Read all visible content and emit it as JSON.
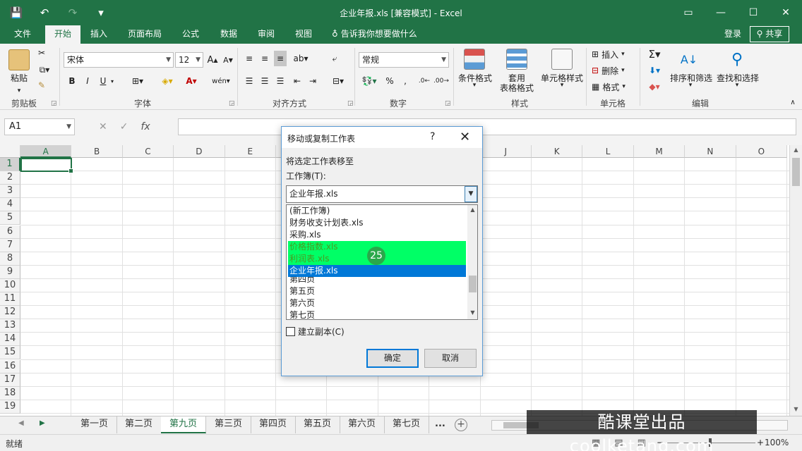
{
  "window": {
    "title": "企业年报.xls  [兼容模式] - Excel"
  },
  "qat": {
    "save": "💾",
    "undo": "↶",
    "redo": "↷",
    "more": "▾"
  },
  "ribbon_tabs": [
    "文件",
    "开始",
    "插入",
    "页面布局",
    "公式",
    "数据",
    "审阅",
    "视图"
  ],
  "active_tab": "开始",
  "tell_me": "告诉我你想要做什么",
  "account": {
    "login": "登录",
    "share": "共享"
  },
  "ribbon": {
    "clipboard": {
      "label": "剪贴板",
      "paste": "粘贴"
    },
    "font": {
      "label": "字体",
      "name": "宋体",
      "size": "12",
      "bold": "B",
      "italic": "I",
      "underline": "U"
    },
    "alignment": {
      "label": "对齐方式"
    },
    "number": {
      "label": "数字",
      "format": "常规",
      "percent": "%"
    },
    "styles": {
      "label": "样式",
      "conditional": "条件格式",
      "table_line1": "套用",
      "table_line2": "表格格式",
      "cell_styles": "单元格样式"
    },
    "cells": {
      "label": "单元格",
      "insert": "插入",
      "delete": "删除",
      "format": "格式"
    },
    "editing": {
      "label": "编辑",
      "sort": "排序和筛选",
      "find": "查找和选择"
    }
  },
  "formula_bar": {
    "name_box": "A1",
    "cancel": "✕",
    "enter": "✓",
    "fx": "fx",
    "value": ""
  },
  "columns": [
    "A",
    "B",
    "C",
    "D",
    "E",
    "F",
    "G",
    "H",
    "I",
    "J",
    "K",
    "L",
    "M",
    "N",
    "O"
  ],
  "rows": [
    "1",
    "2",
    "3",
    "4",
    "5",
    "6",
    "7",
    "8",
    "9",
    "10",
    "11",
    "12",
    "13",
    "14",
    "15",
    "16",
    "17",
    "18",
    "19"
  ],
  "sheets": [
    "第一页",
    "第二页",
    "第九页",
    "第三页",
    "第四页",
    "第五页",
    "第六页",
    "第七页"
  ],
  "active_sheet": "第九页",
  "sheets_more": "...",
  "status": {
    "text": "就绪",
    "zoom": "100%"
  },
  "watermark": "酷课堂出品 coolketang.com",
  "dialog": {
    "title": "移动或复制工作表",
    "help": "?",
    "close": "✕",
    "move_to_label": "将选定工作表移至",
    "workbook_label": "工作簿(T):",
    "workbook_value": "企业年报.xls",
    "list_items": [
      "(新工作簿)",
      "财务收支计划表.xls",
      "采购.xls",
      "价格指数.xls",
      "利润表.xls",
      "企业年报.xls",
      "第四页",
      "第五页",
      "第六页",
      "第七页"
    ],
    "highlighted_item": "利润表.xls",
    "selected_item": "企业年报.xls",
    "copy_label": "建立副本(C)",
    "ok": "确定",
    "cancel": "取消",
    "step_badge": "25"
  },
  "colors": {
    "brand": "#217346",
    "selection": "#0078d7",
    "highlight": "#00ff66"
  }
}
